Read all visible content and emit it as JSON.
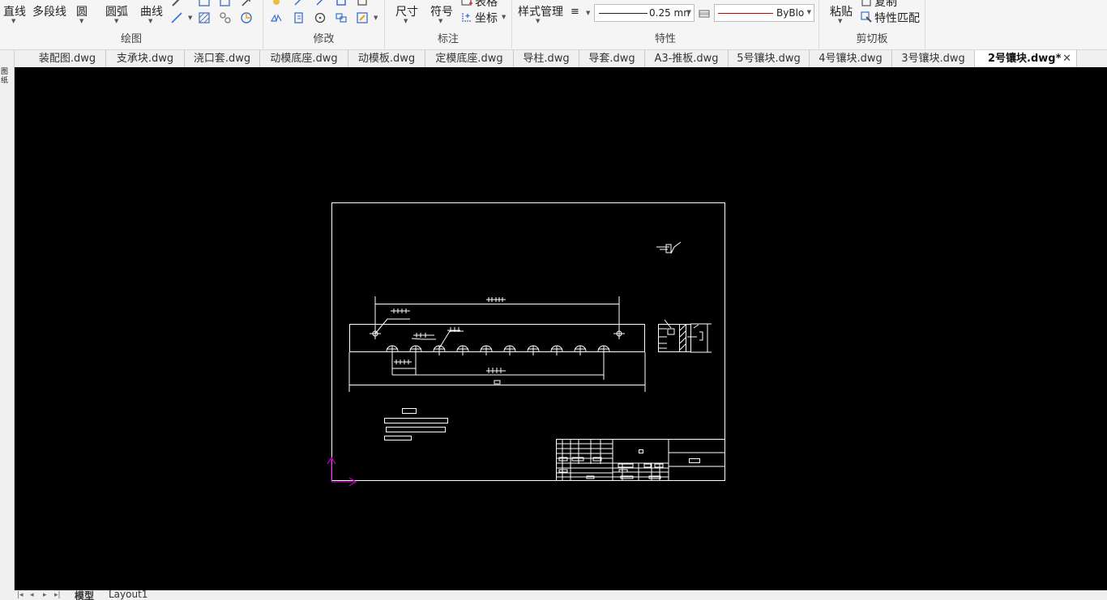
{
  "ribbon": {
    "draw": {
      "label": "绘图",
      "line": "直线",
      "polyline": "多段线",
      "circle": "圆",
      "arc": "圆弧",
      "curve": "曲线"
    },
    "modify": {
      "label": "修改"
    },
    "annotate": {
      "label": "标注",
      "dimension": "尺寸",
      "symbol": "符号",
      "table": "表格",
      "coordinate": "坐标"
    },
    "properties": {
      "label": "特性",
      "style_manager": "样式管理",
      "lineweight": "0.25 mn",
      "color": "ByBloc"
    },
    "clipboard": {
      "label": "剪切板",
      "paste": "粘贴",
      "copy": "复制",
      "match_properties": "特性匹配"
    }
  },
  "tabs": [
    {
      "label": "装配图.dwg"
    },
    {
      "label": "支承块.dwg"
    },
    {
      "label": "浇口套.dwg"
    },
    {
      "label": "动模底座.dwg"
    },
    {
      "label": "动模板.dwg"
    },
    {
      "label": "定模底座.dwg"
    },
    {
      "label": "导柱.dwg"
    },
    {
      "label": "导套.dwg"
    },
    {
      "label": "A3-推板.dwg"
    },
    {
      "label": "5号镶块.dwg"
    },
    {
      "label": "4号镶块.dwg"
    },
    {
      "label": "3号镶块.dwg"
    },
    {
      "label": "2号镶块.dwg*",
      "active": true
    }
  ],
  "left_strip": {
    "label": "图纸"
  },
  "bottom_tabs": [
    {
      "label": "模型",
      "active": true
    },
    {
      "label": "Layout1"
    }
  ],
  "colors": {
    "canvas_bg": "#000000",
    "drawing_lines": "#ffffff",
    "ucs_icon": "#b000b0",
    "color_line": "#cc0000"
  }
}
